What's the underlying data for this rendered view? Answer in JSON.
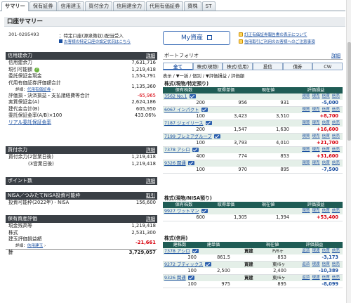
{
  "tabs": [
    "サマリー",
    "保有証券",
    "信用建玉",
    "買付余力",
    "信用建余力",
    "代用有価証券",
    "資株",
    "ST"
  ],
  "title": "口座サマリー",
  "account": {
    "number": "301-0295493",
    "type": "：特定口座(源泉徴収)/配当受入",
    "link": "お客様の特定口座の設定状況はこちら"
  },
  "myasset_label": "My資産",
  "notices": [
    "訂正有価証券報告書の表示について",
    "信用取引ご利用のお客様へのご注意事項"
  ],
  "credit": {
    "header": "信用建余力",
    "detail": "詳細",
    "rows": [
      {
        "label": "信用建余力",
        "value": "7,631,716"
      },
      {
        "label": "現引可能額",
        "value": "1,219,418",
        "q": "?"
      },
      {
        "label": "委託保証金現金",
        "value": "1,554,791"
      },
      {
        "label": "代用有価証券評価額合計",
        "value": "1,135,360"
      },
      {
        "label": "信用建玉評価損益額",
        "value": "-65,965"
      },
      {
        "label": "実質保証金(A)",
        "value": "2,624,186"
      },
      {
        "label": "建代金合計(B)",
        "value": "605,950"
      },
      {
        "label": "委託保証金率(A/B)×100",
        "value": "433.06%"
      }
    ],
    "sub_prefix": "詳細：",
    "sub_link": "代用有価証券",
    "evaluation_line": "評価損・決済損益・支払諸経費等合計",
    "real_link": "リアル委託保証金率"
  },
  "buying": {
    "header": "買付余力",
    "detail": "詳細",
    "rows": [
      {
        "label": "買付余力(2営業日後)",
        "value": "1,219,418"
      },
      {
        "label": "(3営業日後)",
        "value": "1,219,418"
      }
    ]
  },
  "points": {
    "header": "ポイント数",
    "detail": "詳細"
  },
  "nisa": {
    "header": "NISA／つみたてNISA投資可能枠",
    "trade_label": "取引",
    "rows": [
      {
        "label": "投資可能枠(2022年) - NISA",
        "value": "156,600"
      }
    ]
  },
  "holdings": {
    "header": "保有資産評価",
    "detail": "詳細",
    "rows": [
      {
        "label": "現金残高等",
        "value": "1,219,418"
      },
      {
        "label": "株式",
        "value": "2,531,300"
      },
      {
        "label": "建玉評価損益額",
        "value": "-21,661",
        "neg": true
      },
      {
        "label": "計",
        "value": "3,729,057",
        "bold": true
      }
    ],
    "sub_prefix": "詳細：",
    "sub_link": "信用建玉"
  },
  "portfolio": {
    "header": "ポートフォリオ",
    "detail": "詳細",
    "tabs": [
      "全て",
      "株式(現物)",
      "株式(信用)",
      "投信",
      "債券",
      "CW"
    ],
    "sort": "表示 / ▼一括 / 個別 / ▼評価損益 / 評価額",
    "spec_title": "株式(現物/特定預り)",
    "cols": [
      "保有株数",
      "取得単価",
      "現在値",
      "評価損益"
    ],
    "actions": [
      "現買",
      "現売",
      "信買",
      "信売"
    ],
    "spec": [
      {
        "name": "3562 No.1",
        "qty": "200",
        "cost": "956",
        "price": "931",
        "pl": "-5,000"
      },
      {
        "name": "6067 インパクト",
        "qty": "100",
        "cost": "3,423",
        "price": "3,510",
        "pl": "+8,700"
      },
      {
        "name": "7187 ジェイリース",
        "qty": "200",
        "cost": "1,547",
        "price": "1,630",
        "pl": "+16,600"
      },
      {
        "name": "7199 プレミアグループ",
        "qty": "100",
        "cost": "3,793",
        "price": "4,010",
        "pl": "+21,700"
      },
      {
        "name": "7378 アシロ",
        "qty": "400",
        "cost": "774",
        "price": "853",
        "pl": "+31,600"
      },
      {
        "name": "9326 関通",
        "qty": "100",
        "cost": "970",
        "price": "895",
        "pl": "-7,500"
      }
    ],
    "nisa_title": "株式(現物/NISA預り)",
    "nisa": [
      {
        "name": "9927 ワットマン",
        "qty": "600",
        "cost": "1,305",
        "price": "1,394",
        "pl": "+53,400"
      }
    ],
    "credit_title": "株式(信用)",
    "credit_cols": [
      "建株数",
      "建単価",
      "",
      "現在値",
      "評価損益"
    ],
    "credit_actions": [
      "返済",
      "現渡",
      "信買",
      "信売"
    ],
    "credit": [
      {
        "name": "7378 アシロ",
        "side": "買建",
        "term": "P/6ヶ",
        "qty": "300",
        "cost": "861.5",
        "price": "853",
        "pl": "-3,173"
      },
      {
        "name": "9272 ブティックス",
        "side": "買建",
        "term": "東/6ヶ",
        "qty": "100",
        "cost": "2,500",
        "price": "2,400",
        "pl": "-10,389"
      },
      {
        "name": "9326 関通",
        "side": "買建",
        "term": "東/6ヶ",
        "qty": "100",
        "cost": "975",
        "price": "895",
        "pl": "-8,099"
      }
    ]
  }
}
